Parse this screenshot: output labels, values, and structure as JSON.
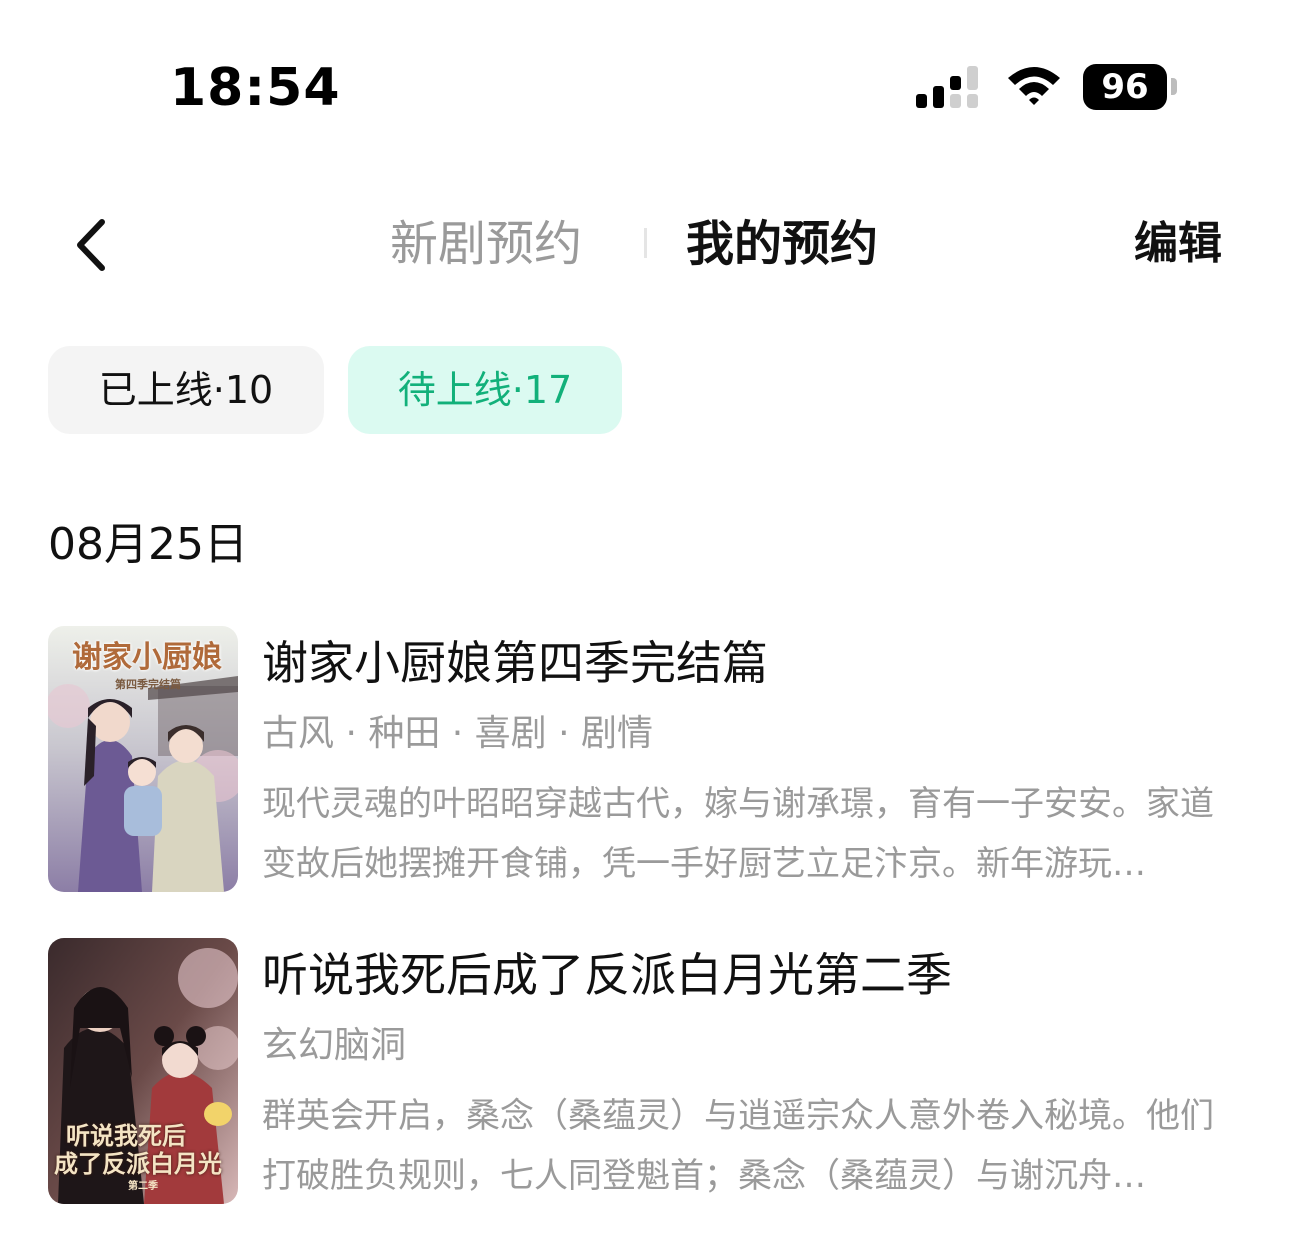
{
  "status_bar": {
    "time": "18:54",
    "battery": "96"
  },
  "nav": {
    "tab_new": "新剧预约",
    "tab_mine": "我的预约",
    "edit_label": "编辑"
  },
  "filters": {
    "online": "已上线·10",
    "upcoming": "待上线·17",
    "active": "upcoming",
    "accent_color": "#12b07a",
    "accent_bg": "#dbfaf1"
  },
  "date_header": "08月25日",
  "dramas": [
    {
      "title": "谢家小厨娘第四季完结篇",
      "tags": "古风 · 种田 · 喜剧 · 剧情",
      "description": "现代灵魂的叶昭昭穿越古代，嫁与谢承璟，育有一子安安。家道变故后她摆摊开食铺，凭一手好厨艺立足汴京。新年游玩…",
      "poster_title": "谢家小厨娘",
      "poster_subtitle": "第四季完结篇"
    },
    {
      "title": "听说我死后成了反派白月光第二季",
      "tags": "玄幻脑洞",
      "description": "群英会开启，桑念（桑蕴灵）与逍遥宗众人意外卷入秘境。他们打破胜负规则，七人同登魁首；桑念（桑蕴灵）与谢沉舟…",
      "poster_title_line1": "听说我死后",
      "poster_title_line2": "成了反派白月光",
      "poster_subtitle": "第二季"
    }
  ]
}
